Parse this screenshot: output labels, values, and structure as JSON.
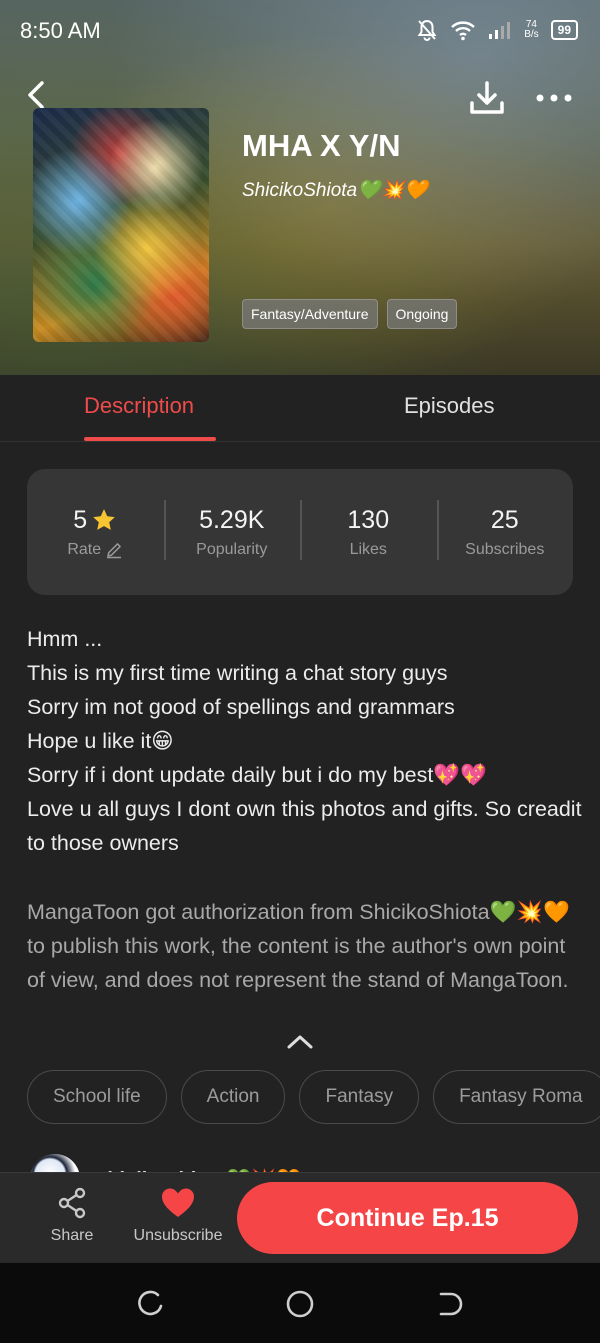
{
  "status_bar": {
    "time": "8:50 AM",
    "net_speed_top": "74",
    "net_speed_bottom": "B/s",
    "battery": "99"
  },
  "header": {
    "title": "MHA X Y/N",
    "author": "ShicikoShiota💚💥🧡",
    "tags": [
      "Fantasy/Adventure",
      "Ongoing"
    ]
  },
  "tabs": {
    "description": "Description",
    "episodes": "Episodes"
  },
  "stats": [
    {
      "value": "5",
      "label": "Rate"
    },
    {
      "value": "5.29K",
      "label": "Popularity"
    },
    {
      "value": "130",
      "label": "Likes"
    },
    {
      "value": "25",
      "label": "Subscribes"
    }
  ],
  "description": {
    "lines": [
      "Hmm ...",
      "This is my first time writing a chat story guys",
      "Sorry im not good of spellings and grammars",
      "Hope u like it😁",
      "Sorry if i dont update daily but i do my best💖💖",
      "Love u all guys     I dont own this photos and gifts. So creadit to those owners"
    ],
    "authorization": "MangaToon got authorization from ShicikoShiota💚💥🧡 to publish this work, the content is the author's own point of view, and does not represent the stand of MangaToon."
  },
  "topics": [
    "School life",
    "Action",
    "Fantasy",
    "Fantasy Roma"
  ],
  "author_peek": "ShicikoShiota💚💥🧡",
  "bottom_bar": {
    "share": "Share",
    "unsubscribe": "Unsubscribe",
    "continue": "Continue Ep.15"
  },
  "colors": {
    "accent": "#f64547",
    "background": "#222222",
    "card": "#363636"
  }
}
